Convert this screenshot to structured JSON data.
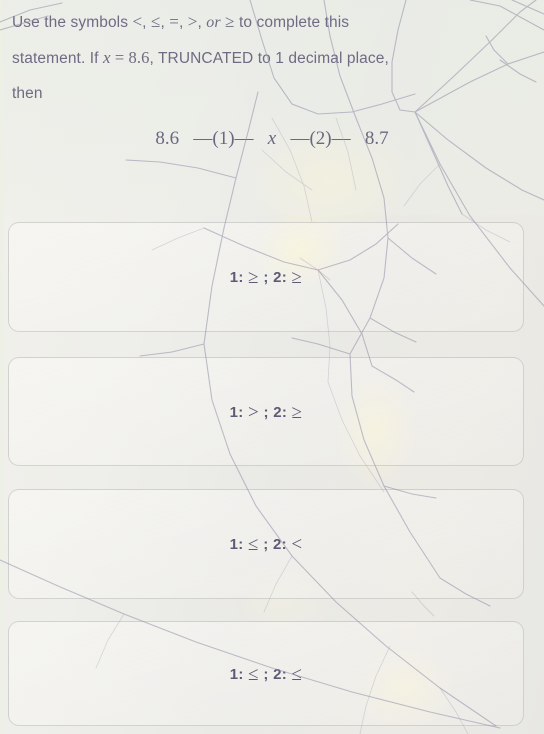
{
  "question": {
    "line1_a": "Use the symbols ",
    "sym_lt": "<",
    "sym_c1": ", ",
    "sym_le": "≤",
    "sym_c2": ", ",
    "sym_eq": "=",
    "sym_c3": ", ",
    "sym_gt": ">",
    "sym_c4": ", ",
    "sym_or": "or",
    "sym_c5": " ",
    "sym_ge": "≥",
    "line1_b": " to complete this",
    "line2_a": "statement. If ",
    "line2_var": "x",
    "line2_eq": " = ",
    "line2_val": "8.6",
    "line2_b": ", TRUNCATED to 1 decimal place,",
    "line3": "then"
  },
  "equation": {
    "left_value": "8.6",
    "blank1": "—(1)—",
    "variable": "x",
    "blank2": "—(2)—",
    "right_value": "8.7"
  },
  "options": [
    {
      "id": "option-a",
      "prefix1": "1: ",
      "op1": "≥",
      "sep": " ; ",
      "prefix2": "2: ",
      "op2": "≥"
    },
    {
      "id": "option-b",
      "prefix1": "1: ",
      "op1": ">",
      "sep": " ; ",
      "prefix2": "2: ",
      "op2": "≥"
    },
    {
      "id": "option-c",
      "prefix1": "1: ",
      "op1": "≤",
      "sep": " ; ",
      "prefix2": "2: ",
      "op2": "<"
    },
    {
      "id": "option-d",
      "prefix1": "1: ",
      "op1": "≤",
      "sep": " ; ",
      "prefix2": "2: ",
      "op2": "≤"
    }
  ],
  "colors": {
    "text": "#6f6b83",
    "option_text": "#5d5b74",
    "background": "#eceae6",
    "bezel": "#12152a",
    "card_border": "rgba(160,160,160,0.40)"
  }
}
